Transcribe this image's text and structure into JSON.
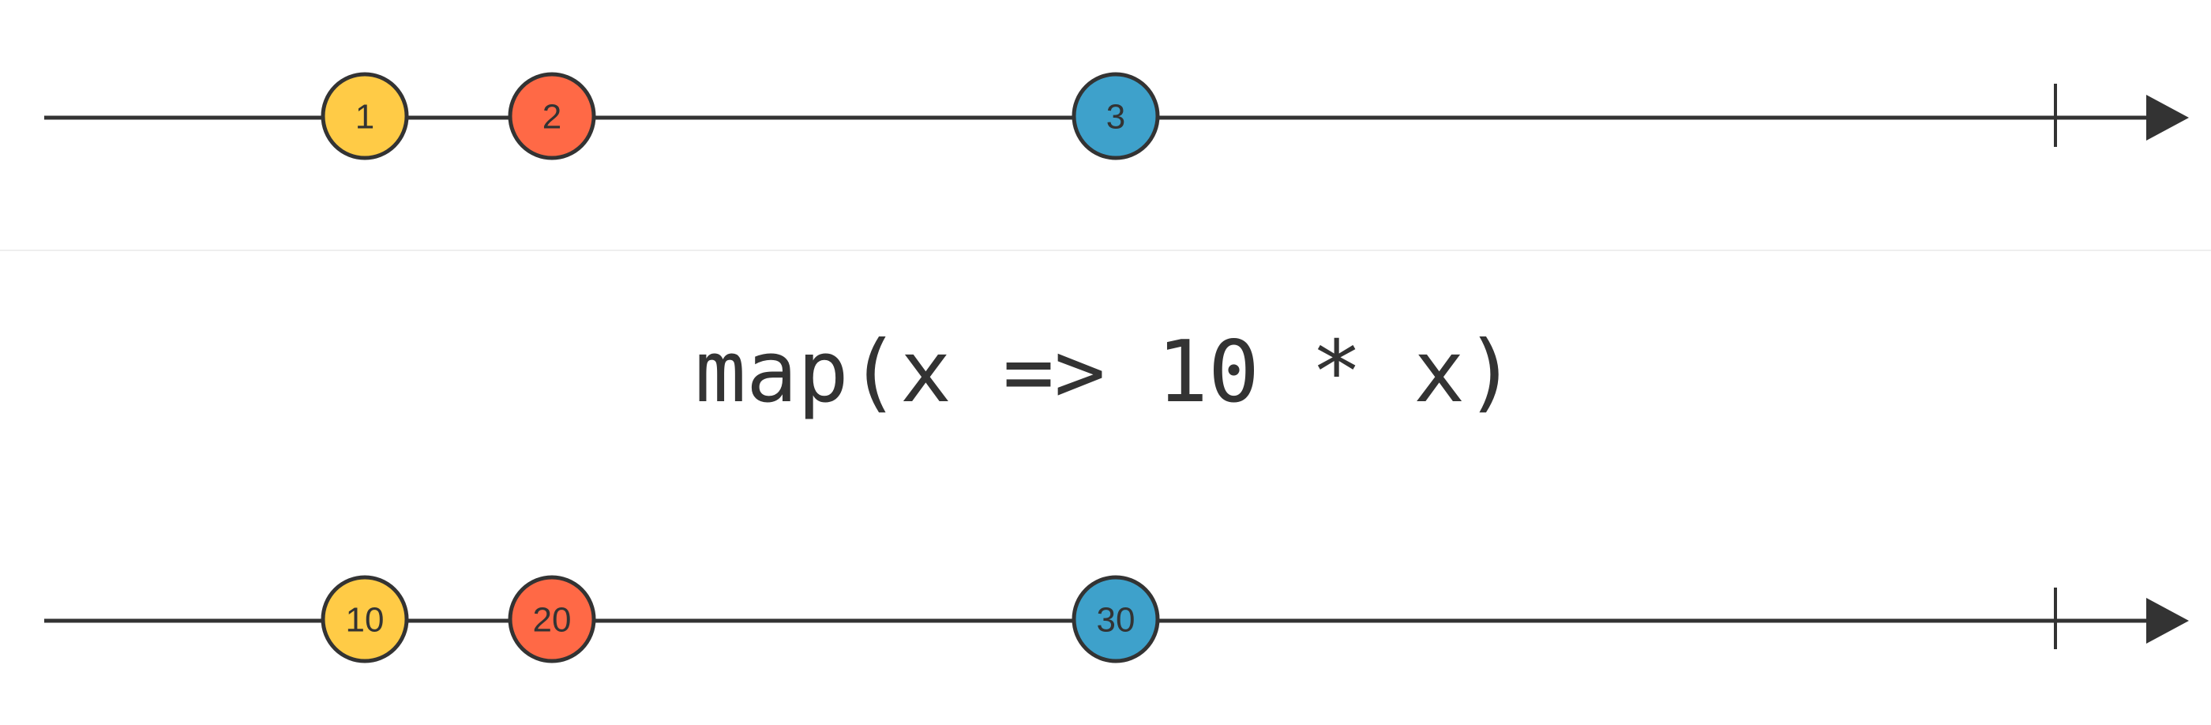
{
  "colors": {
    "line": "#333333",
    "separator": "#eeeeee",
    "background": "#ffffff"
  },
  "input_stream": {
    "marbles": [
      {
        "label": "1",
        "color": "#FFCB46"
      },
      {
        "label": "2",
        "color": "#FF6946"
      },
      {
        "label": "3",
        "color": "#3EA1CB"
      }
    ],
    "completed": true
  },
  "operator": {
    "label": "map(x => 10 * x)"
  },
  "output_stream": {
    "marbles": [
      {
        "label": "10",
        "color": "#FFCB46"
      },
      {
        "label": "20",
        "color": "#FF6946"
      },
      {
        "label": "30",
        "color": "#3EA1CB"
      }
    ],
    "completed": true
  }
}
